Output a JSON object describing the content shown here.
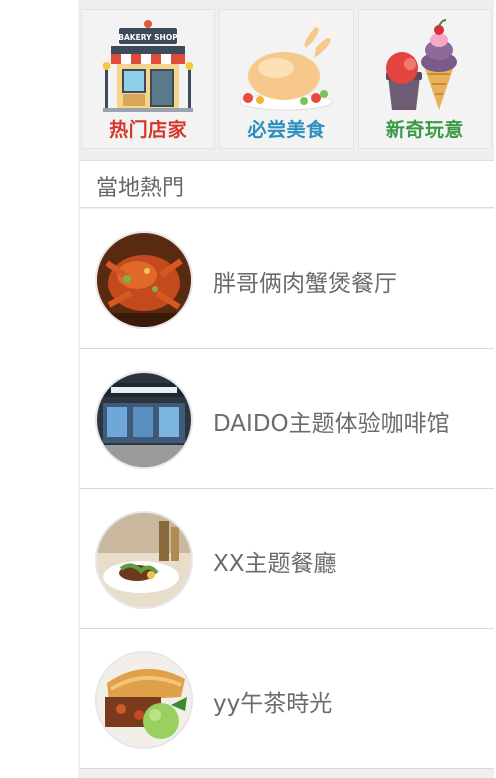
{
  "categories": [
    {
      "label": "热门店家",
      "color": "#d7362b",
      "icon": "bakery-shop-icon",
      "sign": "BAKERY SHOP"
    },
    {
      "label": "必尝美食",
      "color": "#2b8fc0",
      "icon": "roast-chicken-icon"
    },
    {
      "label": "新奇玩意",
      "color": "#3a9a44",
      "icon": "ice-cream-icon"
    }
  ],
  "section": {
    "title": "當地熱門"
  },
  "places": [
    {
      "name": "胖哥俩肉蟹煲餐厅",
      "thumb": "crab-dish-photo"
    },
    {
      "name": "DAIDO主题体验咖啡馆",
      "thumb": "cafe-storefront-photo"
    },
    {
      "name": "XX主题餐廳",
      "thumb": "restaurant-plate-photo"
    },
    {
      "name": "yy午茶時光",
      "thumb": "pie-dessert-photo"
    }
  ]
}
